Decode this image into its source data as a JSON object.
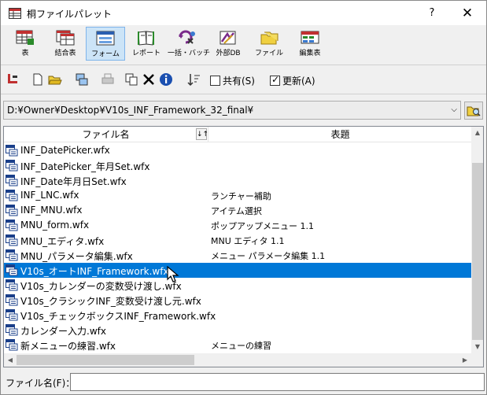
{
  "window": {
    "title": "桐ファイルパレット",
    "help_label": "?",
    "close_label": "✕"
  },
  "toolbar": {
    "buttons": [
      {
        "label": "表",
        "icon": "table-icon"
      },
      {
        "label": "結合表",
        "icon": "joined-table-icon"
      },
      {
        "label": "フォーム",
        "icon": "form-icon",
        "active": true
      },
      {
        "label": "レポート",
        "icon": "report-icon"
      },
      {
        "label": "一括・バッチ",
        "icon": "batch-icon"
      },
      {
        "label": "外部DB",
        "icon": "external-db-icon"
      },
      {
        "label": "ファイル",
        "icon": "file-folder-icon"
      },
      {
        "label": "編集表",
        "icon": "edit-table-icon"
      }
    ]
  },
  "toolbar2": {
    "shared_label": "共有(S)",
    "shared_checked": false,
    "update_label": "更新(A)",
    "update_checked": true
  },
  "path": {
    "value": "D:¥Owner¥Desktop¥V10s_INF_Framework_32_final¥"
  },
  "list": {
    "columns": {
      "name": "ファイル名",
      "title": "表題"
    },
    "sort_label": "↓↑",
    "rows": [
      {
        "name": "INF_DatePicker.wfx",
        "title": ""
      },
      {
        "name": "INF_DatePicker_年月Set.wfx",
        "title": ""
      },
      {
        "name": "INF_Date年月日Set.wfx",
        "title": ""
      },
      {
        "name": "INF_LNC.wfx",
        "title": "ランチャー補助"
      },
      {
        "name": "INF_MNU.wfx",
        "title": "アイテム選択"
      },
      {
        "name": "MNU_form.wfx",
        "title": "ポップアップメニュー 1.1"
      },
      {
        "name": "MNU_エディタ.wfx",
        "title": "MNU エディタ 1.1"
      },
      {
        "name": "MNU_パラメータ編集.wfx",
        "title": "メニュー パラメータ編集 1.1"
      },
      {
        "name": "V10s_オートINF_Framework.wfx",
        "title": "",
        "selected": true
      },
      {
        "name": "V10s_カレンダーの変数受け渡し.wfx",
        "title": ""
      },
      {
        "name": "V10s_クラシックINF_変数受け渡し元.wfx",
        "title": ""
      },
      {
        "name": "V10s_チェックボックスINF_Framework.wfx",
        "title": ""
      },
      {
        "name": "カレンダー入力.wfx",
        "title": ""
      },
      {
        "name": "新メニューの練習.wfx",
        "title": "メニューの練習"
      }
    ]
  },
  "filename": {
    "label": "ファイル名(F)：",
    "value": ""
  },
  "colors": {
    "selection": "#0078d7",
    "active_button": "#cce4f7"
  }
}
